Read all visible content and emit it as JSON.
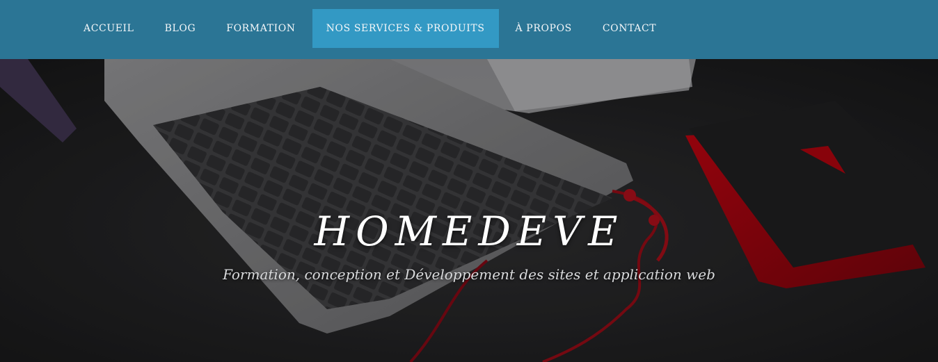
{
  "nav": {
    "items": [
      {
        "label": "ACCUEIL"
      },
      {
        "label": "BLOG"
      },
      {
        "label": "FORMATION"
      },
      {
        "label": "NOS SERVICES & PRODUITS"
      },
      {
        "label": "À PROPOS"
      },
      {
        "label": "CONTACT"
      }
    ],
    "active_index": 3,
    "colors": {
      "bar": "#2b7595",
      "active": "#3399c4",
      "text": "#f4f7f9"
    }
  },
  "hero": {
    "title": "HOMEDEVE",
    "subtitle": "Formation, conception et Développement des sites et application web",
    "background_image": "laptop-desk-photo"
  }
}
